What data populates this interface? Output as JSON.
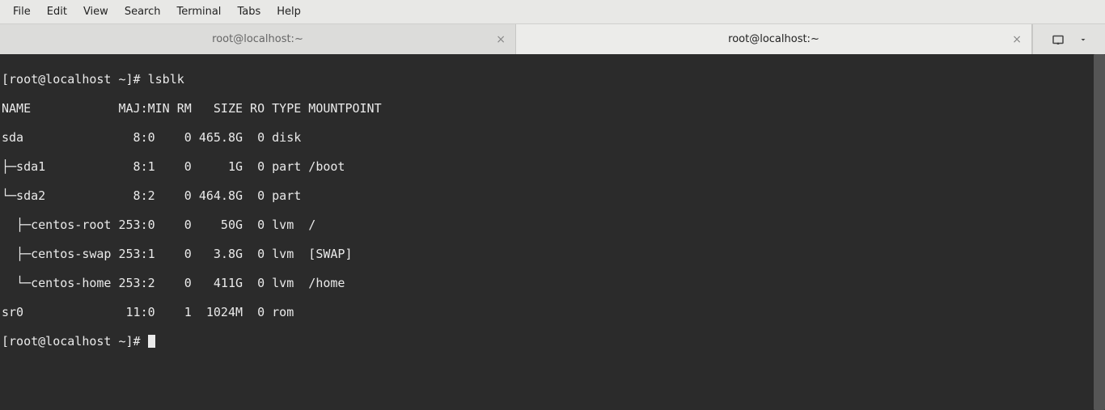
{
  "menubar": {
    "items": [
      "File",
      "Edit",
      "View",
      "Search",
      "Terminal",
      "Tabs",
      "Help"
    ]
  },
  "tabs": [
    {
      "title": "root@localhost:~",
      "active": false
    },
    {
      "title": "root@localhost:~",
      "active": true
    }
  ],
  "terminal": {
    "prompt1": "[root@localhost ~]# ",
    "command1": "lsblk",
    "header": "NAME            MAJ:MIN RM   SIZE RO TYPE MOUNTPOINT",
    "rows": [
      "sda               8:0    0 465.8G  0 disk ",
      "├─sda1            8:1    0     1G  0 part /boot",
      "└─sda2            8:2    0 464.8G  0 part ",
      "  ├─centos-root 253:0    0    50G  0 lvm  /",
      "  ├─centos-swap 253:1    0   3.8G  0 lvm  [SWAP]",
      "  └─centos-home 253:2    0   411G  0 lvm  /home",
      "sr0              11:0    1  1024M  0 rom  "
    ],
    "prompt2": "[root@localhost ~]# "
  },
  "chart_data": {
    "type": "table",
    "title": "lsblk output",
    "columns": [
      "NAME",
      "MAJ:MIN",
      "RM",
      "SIZE",
      "RO",
      "TYPE",
      "MOUNTPOINT"
    ],
    "rows": [
      [
        "sda",
        "8:0",
        0,
        "465.8G",
        0,
        "disk",
        ""
      ],
      [
        "sda1",
        "8:1",
        0,
        "1G",
        0,
        "part",
        "/boot"
      ],
      [
        "sda2",
        "8:2",
        0,
        "464.8G",
        0,
        "part",
        ""
      ],
      [
        "centos-root",
        "253:0",
        0,
        "50G",
        0,
        "lvm",
        "/"
      ],
      [
        "centos-swap",
        "253:1",
        0,
        "3.8G",
        0,
        "lvm",
        "[SWAP]"
      ],
      [
        "centos-home",
        "253:2",
        0,
        "411G",
        0,
        "lvm",
        "/home"
      ],
      [
        "sr0",
        "11:0",
        1,
        "1024M",
        0,
        "rom",
        ""
      ]
    ]
  }
}
